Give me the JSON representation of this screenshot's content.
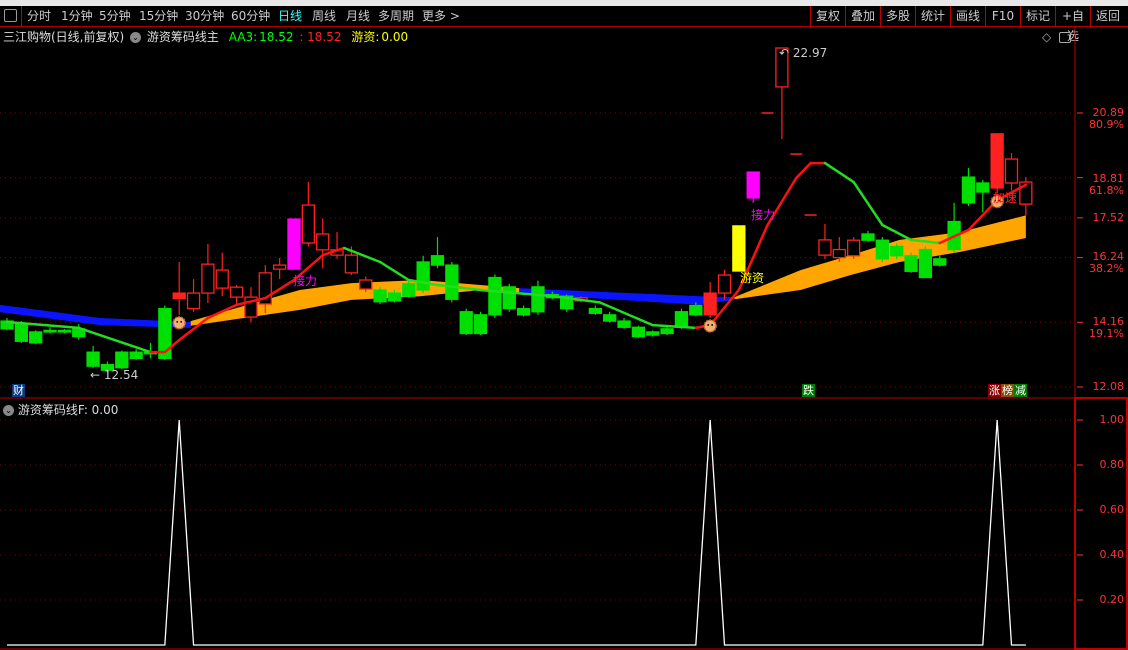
{
  "toolbar": {
    "tabs": [
      "分时",
      "1分钟",
      "5分钟",
      "15分钟",
      "30分钟",
      "60分钟",
      "日线",
      "周线",
      "月线",
      "多周期",
      "更多 >"
    ],
    "active_tab": "日线",
    "right_buttons": [
      "复权",
      "叠加",
      "多股",
      "统计",
      "画线",
      "F10",
      "标记",
      "+自选",
      "返回"
    ]
  },
  "header": {
    "stock": "三江购物(日线,前复权)",
    "indicator": "游资筹码线主",
    "aa3_label": "AA3:",
    "aa3_value": "18.52",
    "sep_value": ": 18.52",
    "youzi_label": "游资:",
    "youzi_value": "0.00"
  },
  "main": {
    "annotations": {
      "low": "← 12.54",
      "high": "22.97",
      "jieli1": "接力",
      "jieli2": "接力",
      "youzi": "游资",
      "jiasu": "加速"
    },
    "tags": {
      "cai": "财",
      "die": "跌",
      "zhang": "涨",
      "bang": "榜",
      "jian": "减"
    },
    "axis": [
      {
        "v": "20.89",
        "p": "80.9%"
      },
      {
        "v": "18.81",
        "p": "61.8%"
      },
      {
        "v": "17.52",
        "p": ""
      },
      {
        "v": "16.24",
        "p": "38.2%"
      },
      {
        "v": "14.16",
        "p": "19.1%"
      },
      {
        "v": "12.08",
        "p": ""
      }
    ]
  },
  "sub": {
    "title": "游资筹码线F",
    "value": ": 0.00",
    "axis": [
      "1.00",
      "0.80",
      "0.60",
      "0.40",
      "0.20"
    ]
  },
  "colors": {
    "up": "#ff2020",
    "down": "#00e000",
    "magenta": "#ff00ff",
    "yellow": "#ffff00",
    "band_orange": "#ffa500",
    "band_blue": "#0a14ff",
    "line_up": "#ff1010",
    "line_down": "#22dd22"
  },
  "chart_data": {
    "type": "candlestick",
    "price_gridlines": [
      20.89,
      18.81,
      17.52,
      16.24,
      14.16,
      12.08
    ],
    "candles": [
      [
        14.2,
        13.95,
        14.3,
        13.9,
        "down"
      ],
      [
        14.1,
        13.55,
        14.2,
        13.5,
        "down"
      ],
      [
        13.85,
        13.5,
        13.9,
        13.45,
        "down"
      ],
      [
        13.9,
        13.85,
        14.0,
        13.8,
        "down"
      ],
      [
        13.9,
        13.85,
        13.95,
        13.8,
        "down"
      ],
      [
        13.95,
        13.7,
        14.1,
        13.6,
        "down"
      ],
      [
        13.2,
        12.75,
        13.4,
        12.7,
        "down"
      ],
      [
        12.8,
        12.62,
        12.9,
        12.54,
        "down"
      ],
      [
        13.2,
        12.7,
        13.25,
        12.65,
        "down"
      ],
      [
        13.2,
        13.0,
        13.3,
        12.95,
        "down"
      ],
      [
        13.2,
        13.15,
        13.5,
        13.0,
        "down"
      ],
      [
        14.6,
        13.0,
        14.7,
        12.95,
        "down"
      ],
      [
        14.93,
        15.1,
        16.1,
        14.4,
        "upfill"
      ],
      [
        14.6,
        15.1,
        15.55,
        14.5,
        "up"
      ],
      [
        15.1,
        16.03,
        16.68,
        14.78,
        "up"
      ],
      [
        15.26,
        15.84,
        16.4,
        15.0,
        "up"
      ],
      [
        14.97,
        15.29,
        15.36,
        14.68,
        "up"
      ],
      [
        14.33,
        14.97,
        15.29,
        14.17,
        "up"
      ],
      [
        14.75,
        15.75,
        16.0,
        14.46,
        "up"
      ],
      [
        15.87,
        16.0,
        16.23,
        15.55,
        "up"
      ],
      [
        15.87,
        17.48,
        17.48,
        15.87,
        "magenta"
      ],
      [
        16.71,
        17.93,
        18.67,
        16.6,
        "up"
      ],
      [
        16.49,
        17.0,
        17.5,
        15.9,
        "up"
      ],
      [
        16.32,
        16.49,
        17.06,
        16.2,
        "up"
      ],
      [
        15.75,
        16.32,
        16.6,
        15.68,
        "up"
      ],
      [
        15.23,
        15.52,
        15.64,
        15.13,
        "up"
      ],
      [
        15.2,
        14.82,
        15.3,
        14.75,
        "down"
      ],
      [
        15.1,
        14.85,
        15.2,
        14.8,
        "down"
      ],
      [
        15.4,
        15.0,
        15.5,
        14.95,
        "down"
      ],
      [
        16.1,
        15.2,
        16.3,
        15.1,
        "down"
      ],
      [
        16.3,
        16.0,
        16.9,
        15.9,
        "down"
      ],
      [
        16.0,
        14.9,
        16.1,
        14.8,
        "down"
      ],
      [
        14.5,
        13.8,
        14.6,
        13.75,
        "down"
      ],
      [
        14.4,
        13.8,
        14.5,
        13.75,
        "down"
      ],
      [
        15.6,
        14.4,
        15.7,
        14.3,
        "down"
      ],
      [
        15.3,
        14.6,
        15.4,
        14.5,
        "down"
      ],
      [
        14.6,
        14.4,
        14.7,
        14.35,
        "down"
      ],
      [
        15.3,
        14.5,
        15.5,
        14.4,
        "down"
      ],
      [
        15.05,
        14.95,
        15.15,
        14.9,
        "down"
      ],
      [
        15.0,
        14.6,
        15.05,
        14.5,
        "down"
      ],
      [
        14.85,
        14.95,
        15.0,
        14.8,
        "up"
      ],
      [
        14.6,
        14.45,
        14.7,
        14.4,
        "down"
      ],
      [
        14.4,
        14.2,
        14.5,
        14.15,
        "down"
      ],
      [
        14.2,
        14.0,
        14.3,
        13.95,
        "down"
      ],
      [
        14.0,
        13.7,
        14.05,
        13.65,
        "down"
      ],
      [
        13.85,
        13.75,
        13.9,
        13.7,
        "down"
      ],
      [
        13.95,
        13.8,
        14.0,
        13.75,
        "down"
      ],
      [
        14.5,
        14.0,
        14.6,
        13.95,
        "down"
      ],
      [
        14.7,
        14.4,
        14.8,
        14.35,
        "down"
      ],
      [
        14.4,
        15.1,
        15.45,
        14.3,
        "upfill"
      ],
      [
        15.1,
        15.68,
        15.84,
        14.88,
        "up"
      ],
      [
        15.81,
        17.26,
        17.26,
        15.81,
        "yellow"
      ],
      [
        18.16,
        18.99,
        18.99,
        18.0,
        "magenta"
      ],
      [
        20.89,
        20.89,
        20.89,
        20.89,
        "up"
      ],
      [
        21.73,
        22.98,
        22.98,
        20.05,
        "up"
      ],
      [
        19.57,
        19.57,
        19.57,
        19.57,
        "up"
      ],
      [
        17.61,
        17.61,
        17.61,
        17.61,
        "up"
      ],
      [
        16.32,
        16.81,
        17.32,
        16.2,
        "up"
      ],
      [
        16.24,
        16.5,
        16.9,
        16.1,
        "up"
      ],
      [
        16.3,
        16.8,
        16.9,
        16.2,
        "up"
      ],
      [
        17.0,
        16.8,
        17.1,
        16.75,
        "down"
      ],
      [
        16.8,
        16.2,
        16.9,
        16.1,
        "down"
      ],
      [
        16.6,
        16.3,
        16.7,
        16.2,
        "down"
      ],
      [
        16.3,
        15.8,
        16.4,
        15.75,
        "down"
      ],
      [
        16.5,
        15.6,
        16.6,
        15.6,
        "down"
      ],
      [
        16.2,
        16.0,
        16.3,
        15.95,
        "down"
      ],
      [
        17.4,
        16.5,
        18.0,
        16.4,
        "down"
      ],
      [
        18.83,
        18.0,
        19.12,
        17.9,
        "down"
      ],
      [
        18.64,
        18.35,
        18.74,
        17.7,
        "down"
      ],
      [
        18.48,
        20.22,
        20.22,
        18.3,
        "upfill"
      ],
      [
        18.64,
        19.41,
        19.6,
        18.4,
        "up"
      ],
      [
        17.96,
        18.67,
        18.83,
        17.6,
        "up"
      ]
    ],
    "ma_line": [
      [
        0,
        14.17
      ],
      [
        5,
        13.98
      ],
      [
        10,
        13.2
      ],
      [
        11,
        13.2
      ],
      [
        12,
        13.59
      ],
      [
        14,
        14.3
      ],
      [
        16,
        14.72
      ],
      [
        18,
        14.94
      ],
      [
        20,
        15.52
      ],
      [
        22,
        16.32
      ],
      [
        23.5,
        16.55
      ],
      [
        26,
        16.1
      ],
      [
        28,
        15.52
      ],
      [
        30,
        15.36
      ],
      [
        33,
        15.2
      ],
      [
        38,
        15.0
      ],
      [
        41.3,
        14.8
      ],
      [
        45,
        14.07
      ],
      [
        48,
        13.98
      ],
      [
        49,
        14.07
      ],
      [
        51,
        15.2
      ],
      [
        53,
        17.29
      ],
      [
        55,
        18.8
      ],
      [
        56,
        19.28
      ],
      [
        57,
        19.28
      ],
      [
        59,
        18.67
      ],
      [
        61,
        17.29
      ],
      [
        63,
        16.81
      ],
      [
        65,
        16.71
      ],
      [
        67,
        17.13
      ],
      [
        69,
        18.09
      ],
      [
        71,
        18.58
      ]
    ],
    "bands": [
      {
        "color": "blue",
        "points": [
          [
            -0.5,
            14.72,
            14.49
          ],
          [
            6.5,
            14.3,
            14.07
          ],
          [
            12.8,
            14.17,
            13.98
          ]
        ]
      },
      {
        "color": "orange",
        "points": [
          [
            12.8,
            14.2,
            14.05
          ],
          [
            20.4,
            15.2,
            14.56
          ],
          [
            24,
            15.42,
            14.88
          ],
          [
            28.8,
            15.52,
            15.0
          ],
          [
            33,
            15.36,
            15.2
          ],
          [
            35.7,
            15.26,
            15.13
          ]
        ]
      },
      {
        "color": "blue",
        "points": [
          [
            35.7,
            15.26,
            15.13
          ],
          [
            38.5,
            15.2,
            15.0
          ],
          [
            48.3,
            15.0,
            14.72
          ],
          [
            50.7,
            14.97,
            14.88
          ]
        ]
      },
      {
        "color": "orange",
        "points": [
          [
            50.7,
            14.97,
            14.9
          ],
          [
            55.3,
            15.84,
            15.2
          ],
          [
            58.8,
            16.32,
            15.68
          ],
          [
            62.2,
            16.81,
            16.1
          ],
          [
            66.4,
            17.06,
            16.42
          ],
          [
            71,
            17.6,
            16.87
          ]
        ]
      }
    ],
    "signal_markers": [
      12,
      49,
      69
    ],
    "sub_series": {
      "spikes_at": [
        12,
        49,
        69
      ],
      "value": 1.0,
      "baseline": 0,
      "ylim": [
        0,
        1.1
      ]
    }
  }
}
